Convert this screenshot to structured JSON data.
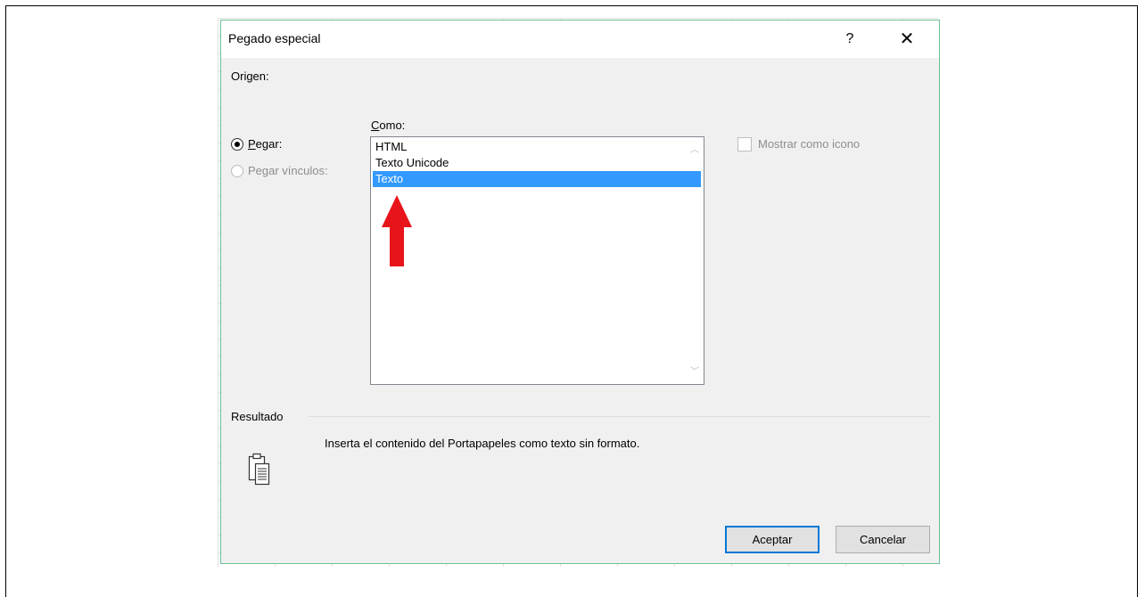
{
  "dialog": {
    "title": "Pegado especial",
    "help": "?",
    "close": "✕"
  },
  "source": {
    "label": "Origen:"
  },
  "options": {
    "paste_first": "P",
    "paste_rest": "egar:",
    "paste_link": "Pegar vínculos:",
    "selected": "paste"
  },
  "as_list": {
    "label_first": "C",
    "label_rest": "omo:",
    "items": [
      "HTML",
      "Texto Unicode",
      "Texto"
    ],
    "selected_index": 2
  },
  "display_as_icon": {
    "label": "Mostrar como icono",
    "checked": false
  },
  "result": {
    "label": "Resultado",
    "description": "Inserta el contenido del Portapapeles como texto sin formato."
  },
  "buttons": {
    "ok": "Aceptar",
    "cancel": "Cancelar"
  },
  "colors": {
    "selection": "#3399ff",
    "annotation_arrow": "#e8141b",
    "dialog_border": "#6fbf97"
  },
  "icons": [
    "help-icon",
    "close-icon",
    "clipboard-icon",
    "red-arrow-annotation",
    "chevron-up-icon",
    "chevron-down-icon"
  ]
}
